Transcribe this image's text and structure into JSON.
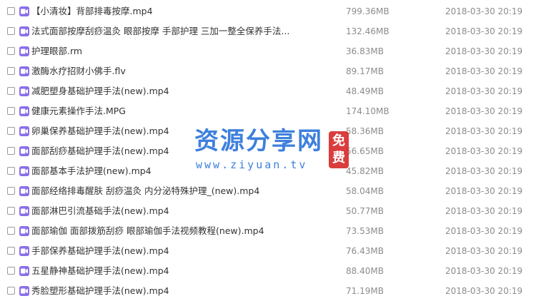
{
  "colors": {
    "video_icon": "#8a6ee8",
    "watermark_blue": "#236ed7",
    "watermark_red": "#d62828",
    "text": "#333333",
    "meta_text": "#8c8c8c"
  },
  "icons": {
    "file_type": "video-icon",
    "selector": "checkbox"
  },
  "files": [
    {
      "name": "【小清妆】背部排毒按摩.mp4",
      "size": "799.36MB",
      "date": "2018-03-30 20:19"
    },
    {
      "name": "法式面部按摩刮痧温灸 眼部按摩 手部护理 三加一整全保养手法...",
      "size": "132.46MB",
      "date": "2018-03-30 20:19"
    },
    {
      "name": "护理眼部.rm",
      "size": "36.83MB",
      "date": "2018-03-30 20:19"
    },
    {
      "name": "激酶水疗招财小佛手.flv",
      "size": "89.17MB",
      "date": "2018-03-30 20:19"
    },
    {
      "name": "减肥塑身基础护理手法(new).mp4",
      "size": "48.49MB",
      "date": "2018-03-30 20:19"
    },
    {
      "name": "健康元素操作手法.MPG",
      "size": "174.10MB",
      "date": "2018-03-30 20:19"
    },
    {
      "name": "卵巢保养基础护理手法(new).mp4",
      "size": "58.36MB",
      "date": "2018-03-30 20:19"
    },
    {
      "name": "面部刮痧基础护理手法(new).mp4",
      "size": "56.65MB",
      "date": "2018-03-30 20:19"
    },
    {
      "name": "面部基本手法护理(new).mp4",
      "size": "45.82MB",
      "date": "2018-03-30 20:19"
    },
    {
      "name": "面部经络排毒醒肤 刮痧温灸 内分泌特殊护理_(new).mp4",
      "size": "58.04MB",
      "date": "2018-03-30 20:19"
    },
    {
      "name": "面部淋巴引流基础手法(new).mp4",
      "size": "50.77MB",
      "date": "2018-03-30 20:19"
    },
    {
      "name": "面部瑜伽 面部拨筋刮痧 眼部瑜伽手法视频教程(new).mp4",
      "size": "73.53MB",
      "date": "2018-03-30 20:19"
    },
    {
      "name": "手部保养基础护理手法(new).mp4",
      "size": "76.43MB",
      "date": "2018-03-30 20:19"
    },
    {
      "name": "五星静神基础护理手法(new).mp4",
      "size": "88.40MB",
      "date": "2018-03-30 20:19"
    },
    {
      "name": "秀脸塑形基础护理手法(new).mp4",
      "size": "71.19MB",
      "date": "2018-03-30 20:19"
    }
  ],
  "watermark": {
    "main": "资源分享网",
    "url": "www.ziyuan.tv",
    "stamp": "免费"
  }
}
